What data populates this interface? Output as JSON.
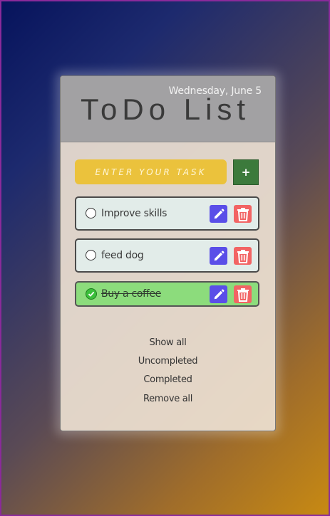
{
  "header": {
    "date": "Wednesday, June 5",
    "title": "ToDo List"
  },
  "input": {
    "placeholder": "ENTER YOUR TASK",
    "add_label": "+"
  },
  "todos": [
    {
      "label": "Improve skills",
      "completed": false
    },
    {
      "label": "feed dog",
      "completed": false
    },
    {
      "label": "Buy a coffee",
      "completed": true
    }
  ],
  "filters": {
    "show_all": "Show all",
    "uncompleted": "Uncompleted",
    "completed": "Completed",
    "remove_all": "Remove all"
  },
  "colors": {
    "input_bg": "#ebc23c",
    "add_button": "#3c7a3c",
    "edit_button": "#5a4ee8",
    "delete_button": "#f26464",
    "completed_row": "#8cdc7c",
    "header_bg": "#a2a1a3"
  },
  "icons": {
    "edit": "pencil-icon",
    "delete": "trash-icon",
    "check": "checkmark-icon"
  }
}
